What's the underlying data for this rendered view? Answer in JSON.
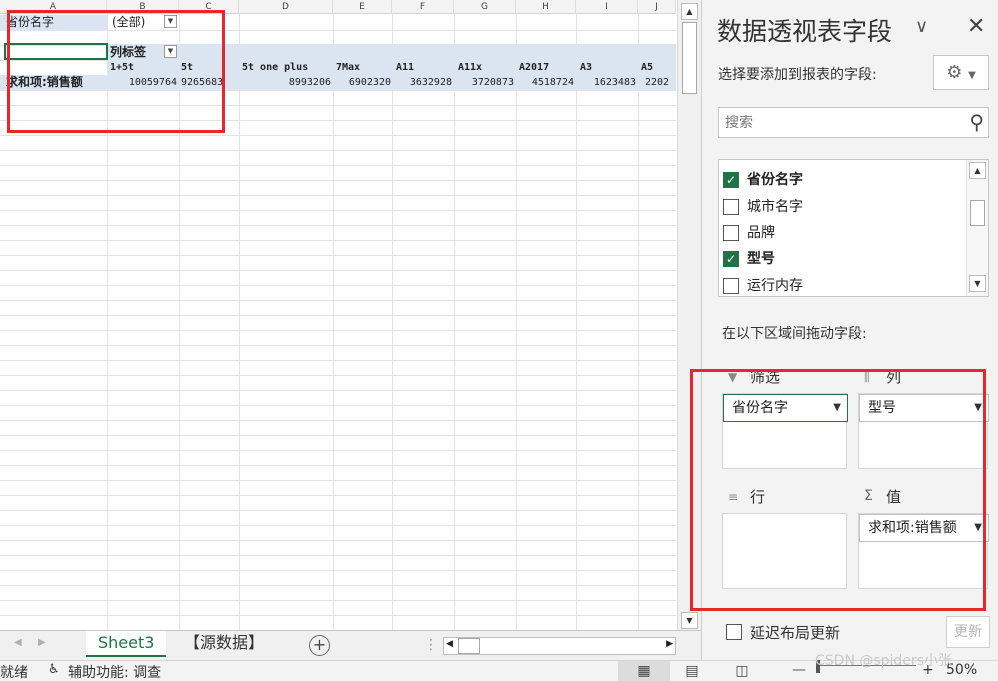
{
  "sheet": {
    "columns": [
      "A",
      "B",
      "C",
      "D",
      "E",
      "F",
      "G",
      "H",
      "I",
      "J"
    ],
    "filter_field": "省份名字",
    "filter_value": "(全部)",
    "col_label_header": "列标签",
    "col_labels": [
      "1+5t",
      "5t",
      "5t one plus",
      "7Max",
      "A11",
      "A11x",
      "A2017",
      "A3",
      "A5"
    ],
    "row_label": "求和项:销售额",
    "values": [
      "10059764",
      "9265683",
      "8993206",
      "6902320",
      "3632928",
      "3720873",
      "4518724",
      "1623483",
      "2202"
    ],
    "dropdown_glyph": "▼"
  },
  "tabs": {
    "prev": "◀",
    "next": "▶",
    "sheets": [
      "Sheet3",
      "【源数据】"
    ],
    "active": "Sheet3",
    "add": "+",
    "more": "⋮"
  },
  "status": {
    "ready": "就绪",
    "accessibility": "辅助功能: 调查",
    "zoom": "50%",
    "zoom_minus": "—",
    "zoom_plus": "+"
  },
  "pane": {
    "title": "数据透视表字段",
    "choose_label": "选择要添加到报表的字段:",
    "search_placeholder": "搜索",
    "fields": [
      {
        "name": "省份名字",
        "checked": true
      },
      {
        "name": "城市名字",
        "checked": false
      },
      {
        "name": "品牌",
        "checked": false
      },
      {
        "name": "型号",
        "checked": true
      },
      {
        "name": "运行内存",
        "checked": false
      }
    ],
    "drag_label": "在以下区域间拖动字段:",
    "areas": {
      "filter": {
        "label": "筛选",
        "items": [
          "省份名字"
        ]
      },
      "columns": {
        "label": "列",
        "items": [
          "型号"
        ]
      },
      "rows": {
        "label": "行",
        "items": []
      },
      "values": {
        "label": "值",
        "items": [
          "求和项:销售额"
        ]
      }
    },
    "defer_label": "延迟布局更新",
    "update_label": "更新"
  },
  "watermark": "CSDN @spiders小张",
  "accent_color": "#217346",
  "highlight_color": "#e8262b"
}
